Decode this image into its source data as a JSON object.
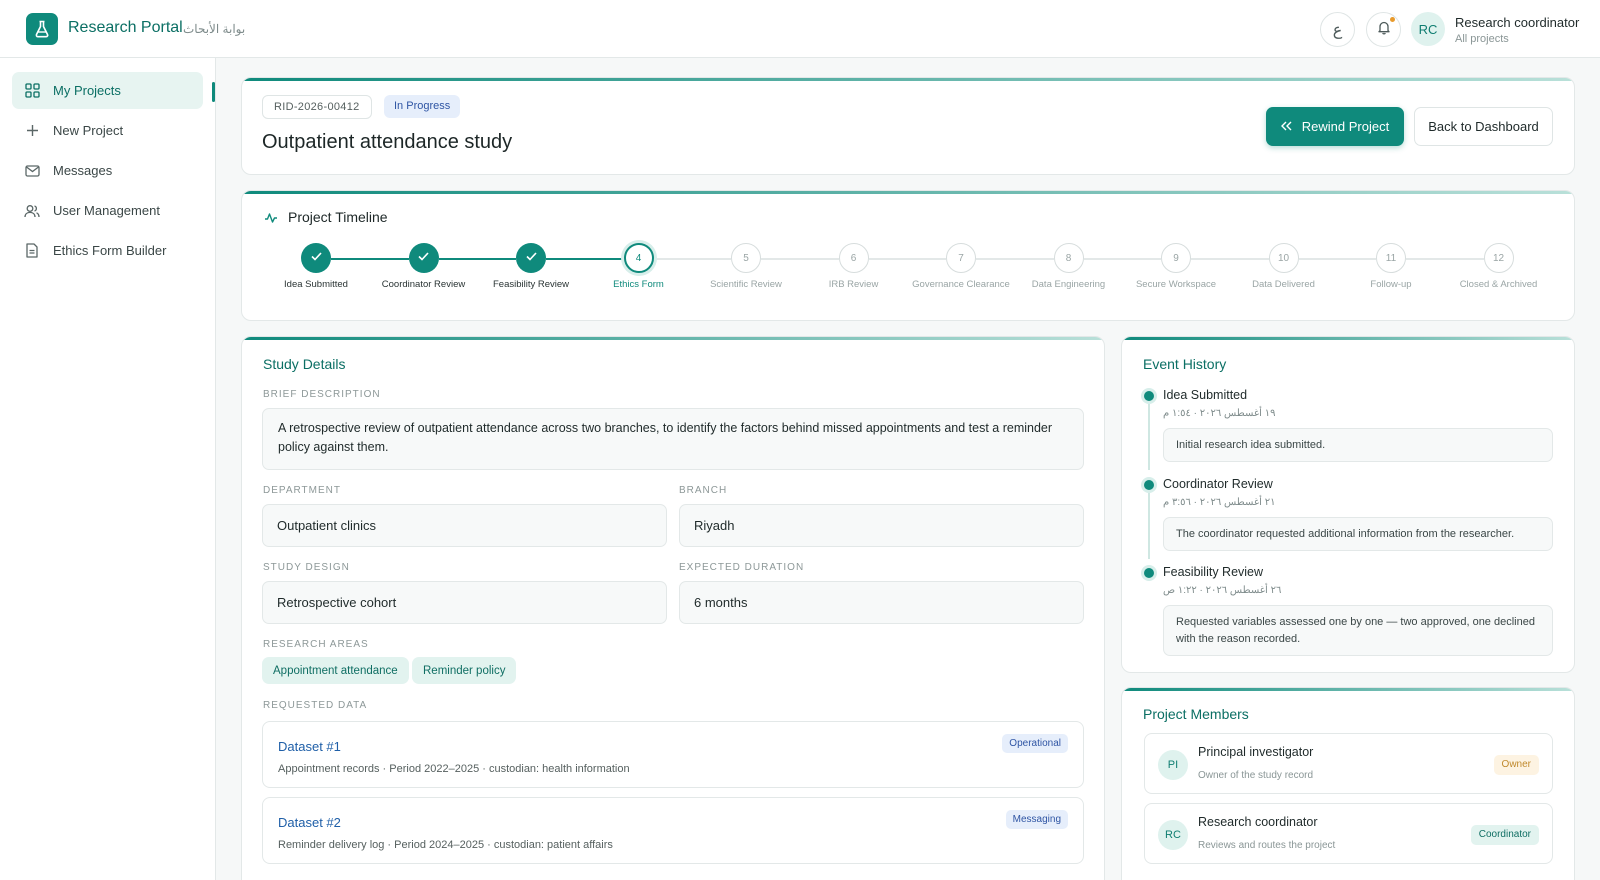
{
  "app": {
    "title": "Research Portal",
    "title_ar": "بوابة الأبحاث",
    "logo_icon": "flask-icon"
  },
  "header": {
    "lang_toggle": "ع",
    "notification_icon": "bell-icon",
    "user": {
      "initials": "RC",
      "name": "Research coordinator",
      "scope": "All projects"
    }
  },
  "sidebar": {
    "items": [
      {
        "label": "My Projects",
        "icon": "grid-icon",
        "active": true
      },
      {
        "label": "New Project",
        "icon": "plus-icon",
        "active": false
      },
      {
        "label": "Messages",
        "icon": "mail-icon",
        "active": false
      },
      {
        "label": "User Management",
        "icon": "users-icon",
        "active": false
      },
      {
        "label": "Ethics Form Builder",
        "icon": "document-icon",
        "active": false
      }
    ]
  },
  "project": {
    "id": "RID-2026-00412",
    "status": "In Progress",
    "title": "Outpatient attendance study",
    "rewind_label": "Rewind Project",
    "back_label": "Back to Dashboard"
  },
  "timeline": {
    "title": "Project Timeline",
    "current_step": 4,
    "steps": [
      {
        "number": "1",
        "label": "Idea Submitted",
        "state": "done"
      },
      {
        "number": "2",
        "label": "Coordinator Review",
        "state": "done"
      },
      {
        "number": "3",
        "label": "Feasibility Review",
        "state": "done"
      },
      {
        "number": "4",
        "label": "Ethics Form",
        "state": "current"
      },
      {
        "number": "5",
        "label": "Scientific Review",
        "state": "pending"
      },
      {
        "number": "6",
        "label": "IRB Review",
        "state": "pending"
      },
      {
        "number": "7",
        "label": "Governance Clearance",
        "state": "pending"
      },
      {
        "number": "8",
        "label": "Data Engineering",
        "state": "pending"
      },
      {
        "number": "9",
        "label": "Secure Workspace",
        "state": "pending"
      },
      {
        "number": "10",
        "label": "Data Delivered",
        "state": "pending"
      },
      {
        "number": "11",
        "label": "Follow-up",
        "state": "pending"
      },
      {
        "number": "12",
        "label": "Closed & Archived",
        "state": "pending"
      }
    ]
  },
  "details": {
    "title": "Study Details",
    "description_label": "BRIEF DESCRIPTION",
    "description": "A retrospective review of outpatient attendance across two branches, to identify the factors behind missed appointments and test a reminder policy against them.",
    "department_label": "DEPARTMENT",
    "department": "Outpatient clinics",
    "branch_label": "BRANCH",
    "branch": "Riyadh",
    "design_label": "STUDY DESIGN",
    "design": "Retrospective cohort",
    "duration_label": "EXPECTED DURATION",
    "duration": "6 months",
    "areas_label": "RESEARCH AREAS",
    "areas": [
      "Appointment attendance",
      "Reminder policy"
    ],
    "requested_label": "REQUESTED DATA",
    "datasets": [
      {
        "name": "Dataset #1",
        "meta": "Appointment records · Period 2022–2025 · custodian: health information",
        "badge": "Operational"
      },
      {
        "name": "Dataset #2",
        "meta": "Reminder delivery log · Period 2024–2025 · custodian: patient affairs",
        "badge": "Messaging"
      }
    ]
  },
  "events": {
    "title": "Event History",
    "items": [
      {
        "title": "Idea Submitted",
        "time": "١٩ أغسطس ٢٠٢٦ · ١:٥٤ م",
        "note": "Initial research idea submitted."
      },
      {
        "title": "Coordinator Review",
        "time": "٢١ أغسطس ٢٠٢٦ · ٣:٥٦ م",
        "note": "The coordinator requested additional information from the researcher."
      },
      {
        "title": "Feasibility Review",
        "time": "٢٦ أغسطس ٢٠٢٦ · ١:٢٢ ص",
        "note": "Requested variables assessed one by one — two approved, one declined with the reason recorded."
      }
    ]
  },
  "members": {
    "title": "Project Members",
    "items": [
      {
        "initials": "PI",
        "name": "Principal investigator",
        "role": "Owner of the study record",
        "badge": "Owner",
        "badge_bg": "#fdf3e2",
        "badge_color": "#c08a2e"
      },
      {
        "initials": "RC",
        "name": "Research coordinator",
        "role": "Reviews and routes the project",
        "badge": "Coordinator",
        "badge_bg": "#e2f3ef",
        "badge_color": "#0f6e63"
      }
    ]
  },
  "colors": {
    "accent": "#0f8a7c",
    "link": "#1f5fa8",
    "status_blue": "#2f55a4"
  }
}
